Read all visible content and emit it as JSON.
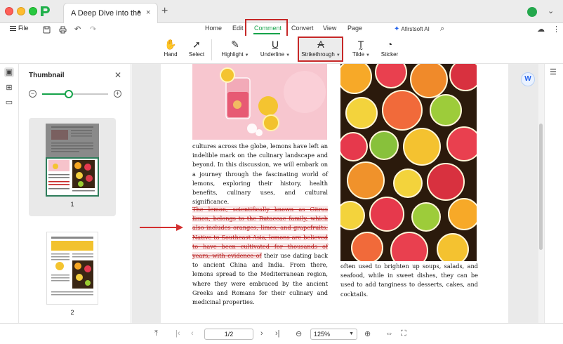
{
  "titlebar": {
    "tab_title": "A Deep Dive into the W...",
    "modified_dot": "•",
    "close_glyph": "×",
    "newtab_glyph": "+"
  },
  "menu": {
    "file_label": "File",
    "tabs": [
      "Home",
      "Edit",
      "Comment",
      "Convert",
      "View",
      "Page"
    ],
    "active_tab": "Comment",
    "ai_label": "Afirstsoft AI"
  },
  "toolbar": {
    "tools": [
      {
        "label": "Hand",
        "icon": "hand-icon"
      },
      {
        "label": "Select",
        "icon": "cursor-icon"
      },
      {
        "label": "Highlight",
        "icon": "highlighter-icon"
      },
      {
        "label": "Underline",
        "icon": "underline-icon"
      },
      {
        "label": "Strikethrough",
        "icon": "strikethrough-icon"
      },
      {
        "label": "Tilde",
        "icon": "tilde-icon"
      },
      {
        "label": "Sticker",
        "icon": "sticker-icon"
      }
    ]
  },
  "thumbnail_panel": {
    "title": "Thumbnail",
    "zoom_level": 0.4,
    "pages": [
      "1",
      "2"
    ]
  },
  "document": {
    "para_left_1": "cultures across the globe, lemons have left an indelible mark on the culinary landscape and beyond. In this discussion, we will embark on a journey through the fascinating world of lemons, exploring their history, health benefits, culinary uses, and cultural significance.",
    "para_left_2_struck": "The lemon, scientifically known as Citrus limon, belongs to the Rutaceae family, which also includes oranges, limes, and grapefruits. Native to Southeast Asia, lemons are believed to have been cultivated for thousands of years, with evidence of",
    "para_left_2_rest": " their use dating back to ancient China and India. From there, lemons spread to the Mediterranean region, where they were embraced by the ancient Greeks and Romans for their culinary and medicinal properties.",
    "para_right": "often used to brighten up soups, salads, and seafood, while in sweet dishes, they can be used to add tanginess to desserts, cakes, and cocktails."
  },
  "bottombar": {
    "page_value": "1/2",
    "zoom_value": "125%"
  },
  "colors": {
    "accent": "#16a34a",
    "annotation_red": "#c62828"
  }
}
